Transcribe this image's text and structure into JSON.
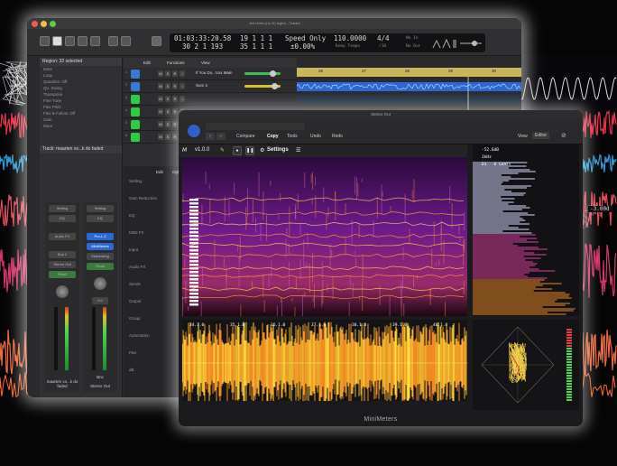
{
  "colors": {
    "accent_green": "#2ecc40",
    "lcd_bg": "#121214",
    "ruler": "#cbb65a",
    "region_blue": "#2a68d6",
    "meter_green": "#4fd154",
    "spectro_purple": "#6c1a8c",
    "wave_orange": "#f08a24"
  },
  "logic": {
    "title": "Jeri remix (no 1!) logicx - Tracks",
    "lcd": {
      "time": "01:03:33:20.58",
      "time2": "30 2 1 193",
      "bars": "19 1 1 1",
      "bars2": "35 1 1 1",
      "mode": "Speed Only",
      "pct": "±0.00%",
      "tempo": "110.0000",
      "tempo_label": "Keep Tempo",
      "sig": "4/4",
      "div": "/16",
      "in": "No In",
      "out": "No Out"
    },
    "inspector": {
      "header": "Region: 32 selected",
      "rows": [
        "Mute",
        "Loop",
        "Quantize: Off",
        "Qu. Swing",
        "Transpose",
        "Fine Tune",
        "Flex Pitch",
        "Flex & Follow: Off",
        "Gain",
        "More"
      ],
      "track": "Track: maarten vs...k do faded",
      "strip1": {
        "setting": "Setting",
        "eq": "EQ",
        "audio_fx": "Audio FX",
        "send": "Bus 2",
        "out": "Stereo Out",
        "read": "Read",
        "name": "maarten vs...k do faded"
      },
      "strip2": {
        "setting": "Setting",
        "eq": "EQ",
        "plugin": "Pro-L 2",
        "plugin2": "MiniMeters",
        "shadow": "Shadowing",
        "read": "Read",
        "vol": "0.0",
        "name": "Stereo Out",
        "bnc": "Bnc"
      }
    },
    "tracks": {
      "menu": [
        "Edit",
        "Functions",
        "View"
      ],
      "rows": [
        {
          "num": "1",
          "name": "If You Do...Vox Main"
        },
        {
          "num": "2",
          "name": "Sum 2"
        },
        {
          "num": "3",
          "name": ""
        },
        {
          "num": "4",
          "name": ""
        },
        {
          "num": "5",
          "name": ""
        },
        {
          "num": "6",
          "name": ""
        }
      ],
      "ruler": [
        "26",
        "27",
        "28",
        "29",
        "30"
      ],
      "region_label": "If You Do...Vox Main"
    },
    "lower": {
      "menu": [
        "Edit",
        "Options"
      ],
      "rows": [
        "Setting",
        "Gain Reduction",
        "EQ",
        "MIDI FX",
        "Input",
        "Audio FX",
        "Sends",
        "Output",
        "Group",
        "Automation",
        "Pan",
        "dB"
      ],
      "values": [
        "Stereo Out",
        "Read",
        "0.0"
      ]
    }
  },
  "minimeters": {
    "title": "Stereo Out",
    "tabs": [
      "Compare",
      "Copy",
      "Tools",
      "Undo",
      "Redo"
    ],
    "view": "View",
    "editor": "Editor",
    "version": "v1.0.0",
    "settings_label": "Settings",
    "footer": "MiniMeters",
    "wave_labels": [
      "34.1.0",
      "35.1.0",
      "36.1.0",
      "37.1.0",
      "38.1.0",
      "39.1.0",
      "40.1.0"
    ],
    "spec_labels": [
      "-52.6dB",
      "1kHz",
      "D1 - 0 Cents"
    ],
    "side_value": "-3.00d"
  }
}
